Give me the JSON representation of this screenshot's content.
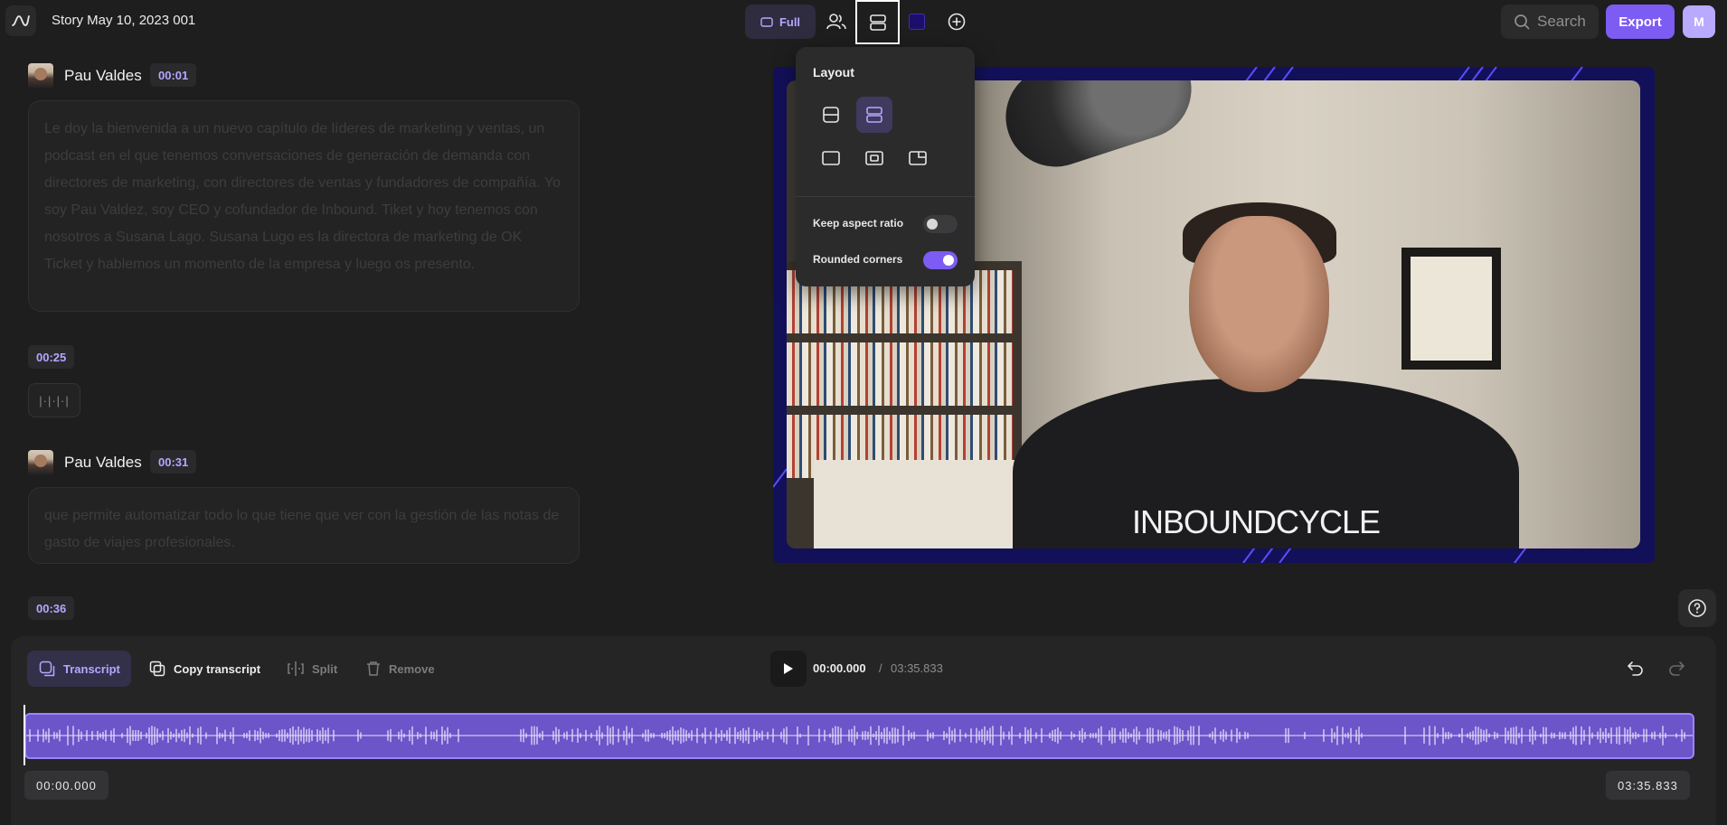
{
  "header": {
    "story_title": "Story May 10, 2023 001",
    "view_mode_label": "Full",
    "search_placeholder": "Search",
    "export_label": "Export",
    "user_initial": "M"
  },
  "transcript": {
    "segments": [
      {
        "speaker": "Pau Valdes",
        "timestamp": "00:01",
        "text": "Le doy la bienvenida a un nuevo capítulo de líderes de marketing y ventas, un podcast en el que tenemos conversaciones de generación de demanda con directores de marketing, con directores de ventas y fundadores de compañía. Yo soy Pau Valdez, soy CEO y cofundador de Inbound. Tiket y hoy tenemos con nosotros a Susana Lago. Susana Lugo es la directora de marketing de OK Ticket y hablemos un momento de la empresa y luego os presento."
      },
      {
        "pause_timestamp": "00:25",
        "pause_glyph": "|·|·|·|"
      },
      {
        "speaker": "Pau Valdes",
        "timestamp": "00:31",
        "text": "que permite automatizar todo lo que tiene que ver con la gestión de las notas de gasto de viajes profesionales."
      },
      {
        "pause_timestamp": "00:36"
      }
    ]
  },
  "preview": {
    "shirt_text": "INBOUNDCYCLE",
    "frame_color": "#13105a"
  },
  "layout_popover": {
    "title": "Layout",
    "options": [
      {
        "icon": "split-horizontal-icon",
        "active": false
      },
      {
        "icon": "stacked-rows-icon",
        "active": true
      },
      {
        "icon": "full-frame-icon",
        "active": false
      },
      {
        "icon": "centered-inset-icon",
        "active": false
      },
      {
        "icon": "corner-inset-icon",
        "active": false
      }
    ],
    "keep_aspect_ratio": {
      "label": "Keep aspect ratio",
      "enabled": false
    },
    "rounded_corners": {
      "label": "Rounded corners",
      "enabled": true
    }
  },
  "toolbar": {
    "transcript_label": "Transcript",
    "copy_transcript_label": "Copy transcript",
    "split_label": "Split",
    "remove_label": "Remove"
  },
  "playback": {
    "current_time": "00:00.000",
    "separator": "/",
    "total_time": "03:35.833"
  },
  "timeline": {
    "start_label": "00:00.000",
    "end_label": "03:35.833",
    "accent_color": "#7c5cf2"
  }
}
